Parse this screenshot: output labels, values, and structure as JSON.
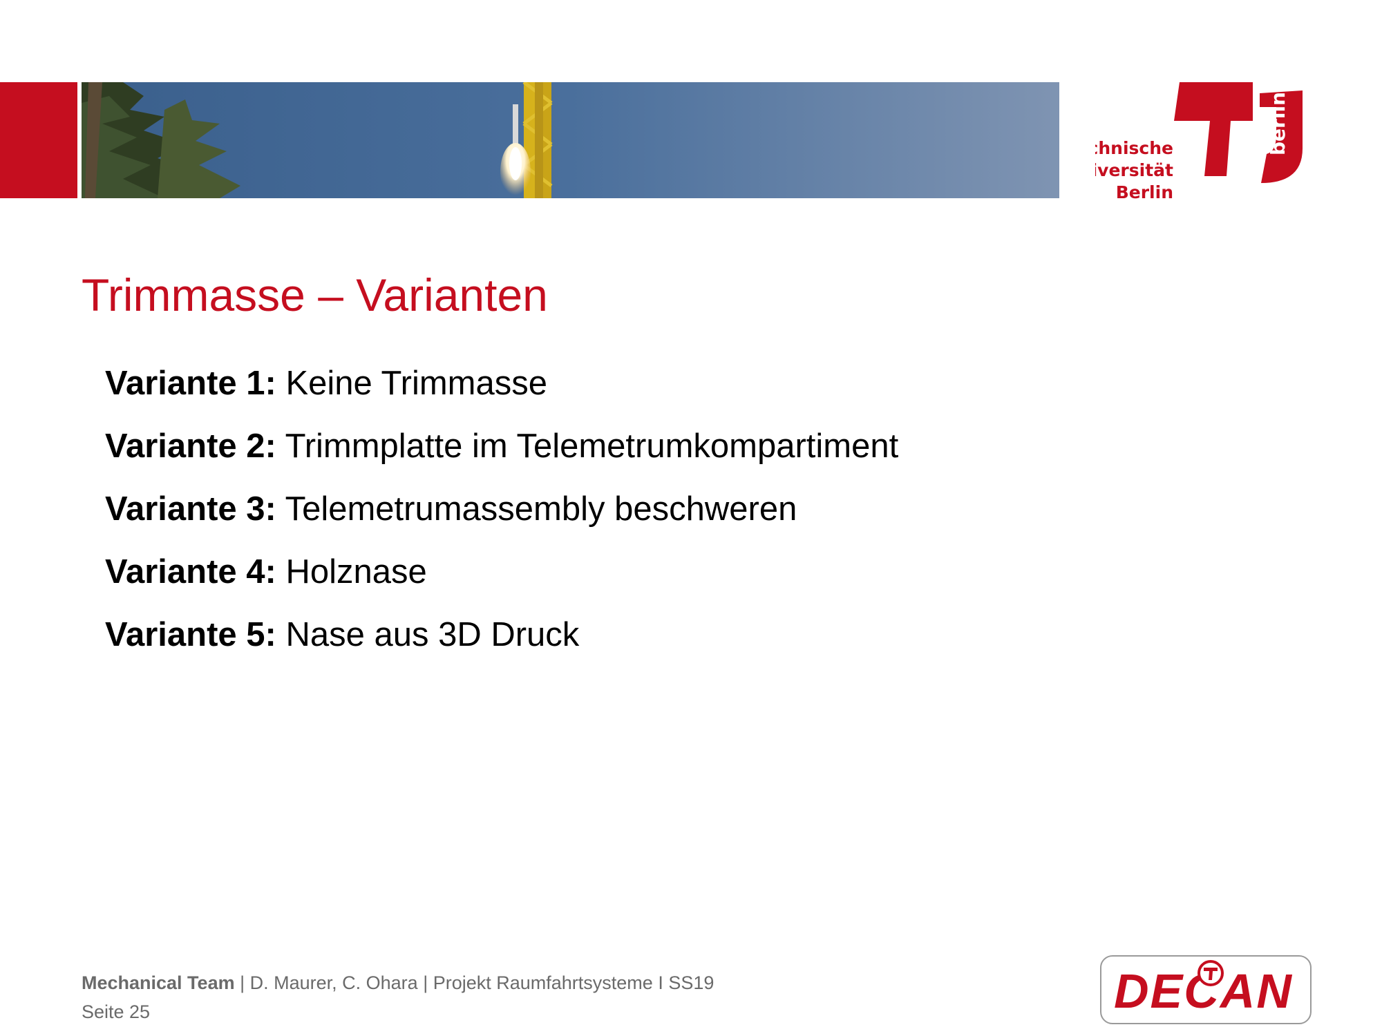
{
  "colors": {
    "accent": "#c50e1f",
    "text": "#000000",
    "footer": "#6a6a6a"
  },
  "logo_tu": {
    "line1": "Technische",
    "line2": "Universität",
    "line3": "Berlin",
    "side": "berlin"
  },
  "title": "Trimmasse – Varianten",
  "variants": [
    {
      "label": "Variante 1:",
      "text": " Keine Trimmasse"
    },
    {
      "label": "Variante 2:",
      "text": " Trimmplatte im Telemetrumkompartiment"
    },
    {
      "label": "Variante 3:",
      "text": " Telemetrumassembly beschweren"
    },
    {
      "label": "Variante 4:",
      "text": " Holznase"
    },
    {
      "label": "Variante 5:",
      "text": " Nase aus 3D Druck"
    }
  ],
  "footer": {
    "team": "Mechanical Team",
    "details": " |  D. Maurer, C. Ohara | Projekt Raumfahrtsysteme I SS19",
    "page": "Seite 25"
  },
  "logo_decan": {
    "text": "DECAN",
    "badge_icon": "tu-badge-icon"
  },
  "banner": {
    "icon": "rocket-launch-photo"
  }
}
